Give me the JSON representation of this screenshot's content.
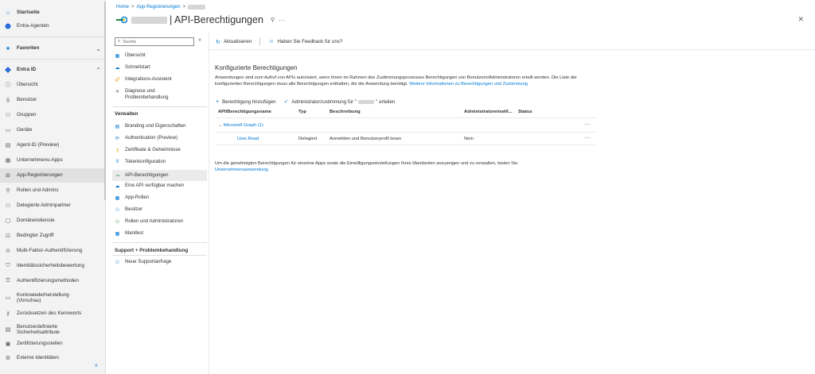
{
  "leftnav": {
    "home": "Startseite",
    "entra_agents": "Entra-Agenten",
    "favorites": "Favoriten",
    "entra_id": "Entra ID",
    "items": [
      "Übersicht",
      "Benutzer",
      "Gruppen",
      "Geräte",
      "Agent-ID (Preview)",
      "Unternehmens-Apps",
      "App-Registrierungen",
      "Rollen und Admins",
      "Delegierte Adminpartner",
      "Domänendienste",
      "Bedingter Zugriff",
      "Multi-Faktor-Authentifizierung",
      "Identitätssicherheitsbewertung",
      "Authentifizierungsmethoden",
      "Kontowiederherstellung (Vorschau)",
      "Zurücksetzen des Kennworts",
      "Benutzerdefinierte Sicherheitsattribute",
      "Zertifizierungsstellen",
      "Externe Identitäten"
    ],
    "collapse": "«"
  },
  "breadcrumb": {
    "home": "Home",
    "sep": ">",
    "app_regs": "App-Registrierungen"
  },
  "header": {
    "title": "| API-Berechtigungen",
    "pin": "⚲",
    "more": "···",
    "close": "✕"
  },
  "blade": {
    "search_placeholder": "Suche",
    "collapse": "«",
    "items_top": [
      "Übersicht",
      "Schnellstart",
      "Integrations-Assistent",
      "Diagnose und Problembehandlung"
    ],
    "manage_heading": "Verwalten",
    "manage_items": [
      "Branding und Eigenschaften",
      "Authentication (Preview)",
      "Zertifikate & Geheimnisse",
      "Tokenkonfiguration",
      "API-Berechtigungen",
      "Eine API verfügbar machen",
      "App-Rollen",
      "Besitzer",
      "Rollen und Administratoren",
      "Manifest"
    ],
    "support_heading": "Support + Problembehandlung",
    "support_items": [
      "Neue Supportanfrage"
    ]
  },
  "toolbar": {
    "refresh": "Aktualisieren",
    "feedback": "Haben Sie Feedback für uns?"
  },
  "content": {
    "title": "Konfigurierte Berechtigungen",
    "desc": "Anwendungen sind zum Aufruf von APIs autorisiert, wenn ihnen im Rahmen des Zustimmungsprozesses Berechtigungen von Benutzern/Administratoren erteilt werden. Die Liste der konfigurierten Berechtigungen muss alle Berechtigungen enthalten, die die Anwendung benötigt.",
    "desc_link": "Weitere Informationen zu Berechtigungen und Zustimmung",
    "add_permission": "Berechtigung hinzufügen",
    "grant_consent_prefix": "Administratorzustimmung für",
    "grant_consent_suffix": "erteilen",
    "table": {
      "headers": [
        "API/Berechtigungsname",
        "Typ",
        "Beschreibung",
        "Administratoreinwill...",
        "Status"
      ],
      "group": "Microsoft Graph (1)",
      "rows": [
        {
          "name": "User.Read",
          "type": "Delegiert",
          "desc": "Anmelden und Benutzerprofil lesen",
          "admin": "Nein",
          "status": ""
        }
      ],
      "more": "···"
    },
    "footer": "Um die genehmigten Berechtigungen für einzelne Apps sowie die Einwilligungseinstellungen Ihres Mandanten anzuzeigen und zu verwalten, testen Sie",
    "footer_link": "Unternehmensanwendung."
  },
  "colors": {
    "accent": "#0078d4",
    "nav_bg": "#f3f3f3",
    "active_bg": "#e1e1e1"
  }
}
